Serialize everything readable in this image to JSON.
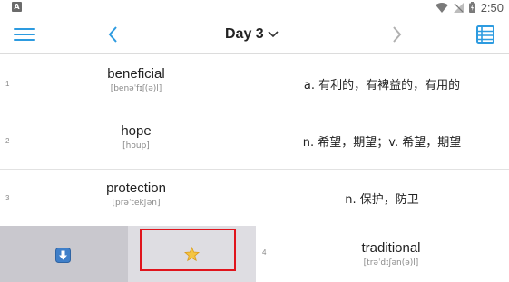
{
  "status_bar": {
    "app_icon_letter": "A",
    "time": "2:50"
  },
  "toolbar": {
    "title": "Day 3",
    "menu_icon": "hamburger-menu-icon",
    "prev_icon": "chevron-left-icon",
    "next_icon": "chevron-right-icon",
    "list_icon": "list-view-icon",
    "accent_color": "#2d9be0"
  },
  "words": [
    {
      "index": "1",
      "word": "beneficial",
      "phonetic": "[benəˈfɪʃ(ə)l]",
      "meaning": "a. 有利的，有裨益的，有用的"
    },
    {
      "index": "2",
      "word": "hope",
      "phonetic": "[houp]",
      "meaning": "n. 希望，期望；v. 希望，期望"
    },
    {
      "index": "3",
      "word": "protection",
      "phonetic": "[prəˈtekʃən]",
      "meaning": "n. 保护，防卫"
    },
    {
      "index": "4",
      "word": "traditional",
      "phonetic": "[trəˈdɪʃən(ə)l]"
    }
  ],
  "swipe_actions": {
    "left_icon": "download-arrow-icon",
    "right_icon": "star-icon",
    "highlight_color": "#e0141c"
  }
}
